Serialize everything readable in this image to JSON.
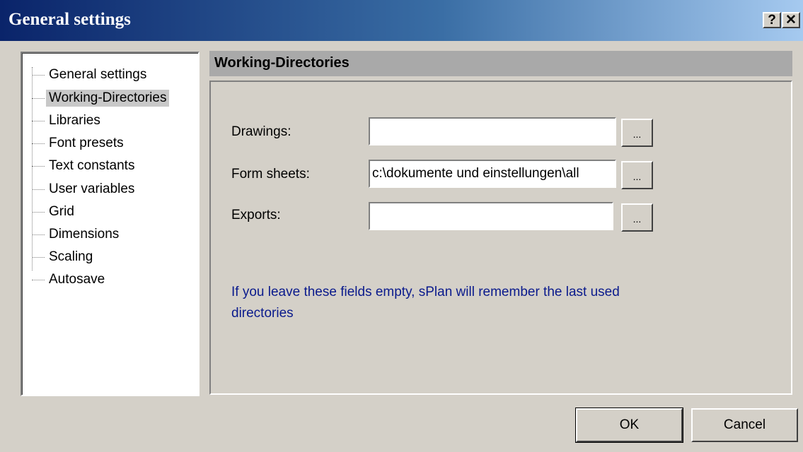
{
  "window": {
    "title": "General settings",
    "help_glyph": "?",
    "close_glyph": "✕"
  },
  "tree": {
    "items": [
      {
        "label": "General settings"
      },
      {
        "label": "Working-Directories",
        "selected": true
      },
      {
        "label": "Libraries"
      },
      {
        "label": "Font presets"
      },
      {
        "label": "Text constants"
      },
      {
        "label": "User variables"
      },
      {
        "label": "Grid"
      },
      {
        "label": "Dimensions"
      },
      {
        "label": "Scaling"
      },
      {
        "label": "Autosave"
      }
    ]
  },
  "section": {
    "title": "Working-Directories"
  },
  "fields": {
    "drawings": {
      "label": "Drawings:",
      "value": ""
    },
    "form_sheets": {
      "label": "Form sheets:",
      "value": "c:\\dokumente und einstellungen\\all"
    },
    "exports": {
      "label": "Exports:",
      "value": ""
    },
    "browse_label": "..."
  },
  "info": {
    "text": "If you leave these fields empty, sPlan will remember the last used directories"
  },
  "buttons": {
    "ok": "OK",
    "cancel": "Cancel"
  },
  "colors": {
    "titlebar_start": "#0a246a",
    "info_text": "#0a1a8c"
  }
}
